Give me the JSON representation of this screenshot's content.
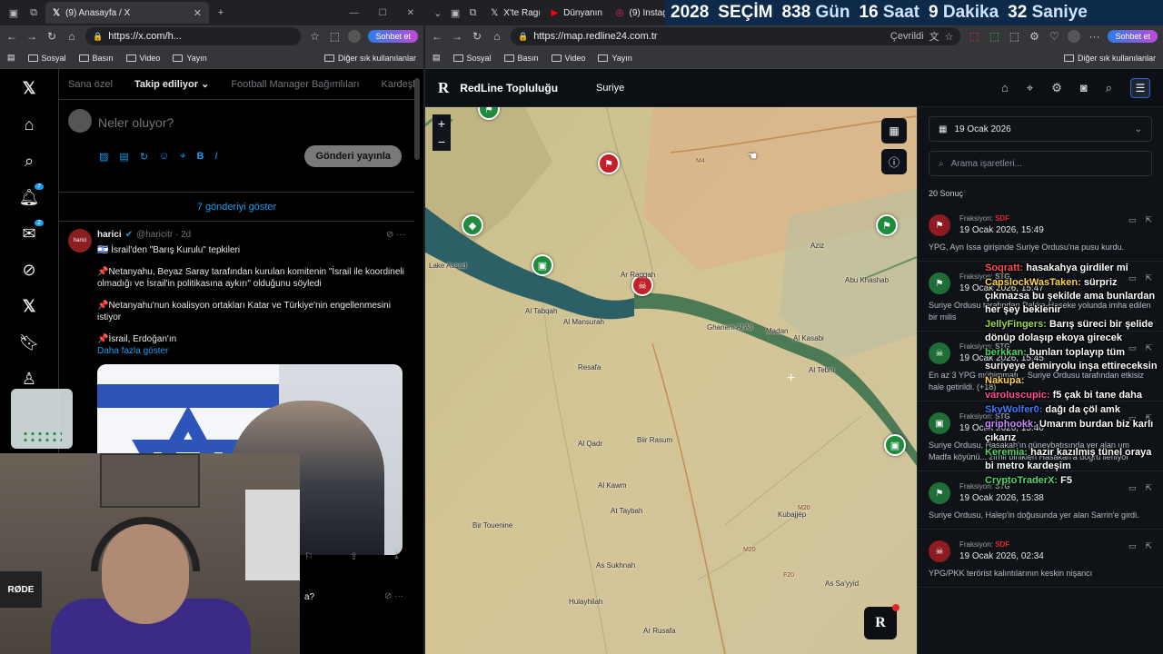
{
  "left_browser": {
    "tabs": [
      {
        "title": "(9) Anasayfa / X"
      }
    ],
    "url": "https://x.com/h...",
    "copilot_label": "Sohbet et",
    "bookmarks": [
      "Sosyal",
      "Basın",
      "Video",
      "Yayın"
    ],
    "bookmarks_other": "Diğer sık kullanılanlar"
  },
  "x": {
    "nav_badges": {
      "notifications": "7",
      "messages": "2"
    },
    "tabs": [
      "Sana özel",
      "Takip ediliyor",
      "Football Manager Bağımlıları",
      "Kardeşler Kr"
    ],
    "compose_placeholder": "Neler oluyor?",
    "post_button": "Gönderi yayınla",
    "show_posts": "7 gönderiyi göster",
    "post": {
      "avatar_text": "harici",
      "name": "harici",
      "handle": "@haricitr · 2d",
      "line1": "🇮🇱 İsrail'den \"Barış Kurulu\" tepkileri",
      "line2": "📌Netanyahu, Beyaz Saray tarafından kurulan komitenin \"İsrail ile koordineli olmadığı ve İsrail'in politikasına aykırı\" olduğunu söyledi",
      "line3": "📌Netanyahu'nun koalisyon ortakları Katar ve Türkiye'nin engellenmesini istiyor",
      "line4": "📌İsrail, Erdoğan'ın",
      "more": "Daha fazla göster"
    },
    "post2_fragment": "a?"
  },
  "webcam": {
    "mic_brand": "RØDE"
  },
  "right_browser": {
    "tabs": [
      "X'te Ragıp",
      "Dünyanın",
      "(9) Instag"
    ],
    "url": "https://map.redline24.com.tr",
    "translated": "Çevrildi",
    "copilot_label": "Sohbet et",
    "bookmarks": [
      "Sosyal",
      "Basın",
      "Video",
      "Yayın"
    ],
    "bookmarks_other": "Diğer sık kullanılanlar"
  },
  "countdown": {
    "year": "2028",
    "label": "SEÇİM",
    "days": "838",
    "days_unit": "Gün",
    "hours": "16",
    "hours_unit": "Saat",
    "minutes": "9",
    "minutes_unit": "Dakika",
    "seconds": "32",
    "seconds_unit": "Saniye"
  },
  "redline": {
    "logo": "R",
    "title": "RedLine Topluluğu",
    "country": "Suriye",
    "zoom_in": "+",
    "zoom_out": "−",
    "date": "19 Ocak 2026",
    "search_placeholder": "Arama işaretleri...",
    "result_count": "20 Sonuç",
    "places": [
      "Lake Assad",
      "Al Tabqah",
      "Al Mansurah",
      "Ar Raqqah",
      "Ghanem Al Ali",
      "Madan",
      "Al Kasabi",
      "Al Tebni",
      "Resafa",
      "Abu Khashab",
      "Aziz",
      "Al Qadr",
      "Biir Rasum",
      "Al Kawm",
      "At Taybah",
      "Kubajjep",
      "As Sukhnah",
      "Bir Touenine",
      "Hulayhilah",
      "As Sa'yyid",
      "Ar Rusafa"
    ],
    "road_labels": [
      "M4",
      "M20",
      "M20",
      "F20"
    ],
    "events": [
      {
        "faction_label": "Fraksiyon:",
        "faction": "SDF",
        "date": "19 Ocak 2026, 15:49",
        "desc": "YPG, Ayn Issa girişinde Suriye Ordusu'na pusu kurdu.",
        "color": "red"
      },
      {
        "faction_label": "Fraksiyon:",
        "faction": "STG",
        "date": "19 Ocak 2026, 15:47",
        "desc": "Suriye Ordusu tarafından Rakka-Haseke yolunda imha edilen bir milis",
        "color": "green"
      },
      {
        "faction_label": "Fraksiyon:",
        "faction": "STG",
        "date": "19 Ocak 2026, 15:45",
        "desc": "En az 3 YPG mühimmatı... Suriye Ordusu tarafından etkisiz hale getirildi. (+18)",
        "color": "green"
      },
      {
        "faction_label": "Fraksiyon:",
        "faction": "STG",
        "date": "19 Ocak 2026, 15:40",
        "desc": "Suriye Ordusu, Hasakah'ın güneybatısında yer alan um Madfa köyünü... zırhlı birlikleri Hasakah'a doğru ilerliyor",
        "color": "green"
      },
      {
        "faction_label": "Fraksiyon:",
        "faction": "STG",
        "date": "19 Ocak 2026, 15:38",
        "desc": "Suriye Ordusu, Halep'in doğusunda yer alan Sarrin'e girdi.",
        "color": "green"
      },
      {
        "faction_label": "Fraksiyon:",
        "faction": "SDF",
        "date": "19 Ocak 2026, 02:34",
        "desc": "YPG/PKK terörist kalıntılarının keskin nişancı",
        "color": "red"
      }
    ]
  },
  "chat": [
    {
      "user": "Soqratt:",
      "text": "hasakahya girdiler mi",
      "color": "#ff4d4d"
    },
    {
      "user": "CapslockWasTaken:",
      "text": "sürpriz çıkmazsa bu şekilde ama bunlardan her şey beklenir",
      "color": "#ffd44d"
    },
    {
      "user": "JellyFingers:",
      "text": "Barış süreci bir şelide dönüp dolaşıp ekoya girecek",
      "color": "#9ad94a"
    },
    {
      "user": "berkkan:",
      "text": "bunları toplayıp tüm suriyeye demiryolu inşa ettireceksin",
      "color": "#4dd96a"
    },
    {
      "user": "Nakupa:",
      "text": "",
      "color": "#ffd44d"
    },
    {
      "user": "varoluscupic:",
      "text": "f5 çak bi tane daha",
      "color": "#ff4d8f"
    },
    {
      "user": "SkyWolfer0:",
      "text": "dağı da çöl amk",
      "color": "#3e7bff"
    },
    {
      "user": "griphookk:",
      "text": "Umarım burdan biz karlı çıkarız",
      "color": "#c78bff"
    },
    {
      "user": "Keremia:",
      "text": "hazır kazılmış tünel oraya bi metro kardeşim",
      "color": "#4dd96a"
    },
    {
      "user": "CryptoTraderX:",
      "text": "F5",
      "color": "#4dd96a"
    }
  ],
  "colors": {
    "x_blue": "#1d9bf0",
    "redline_red": "#e3262e",
    "marker_green": "#1f8b3c",
    "marker_red": "#c4202a"
  }
}
